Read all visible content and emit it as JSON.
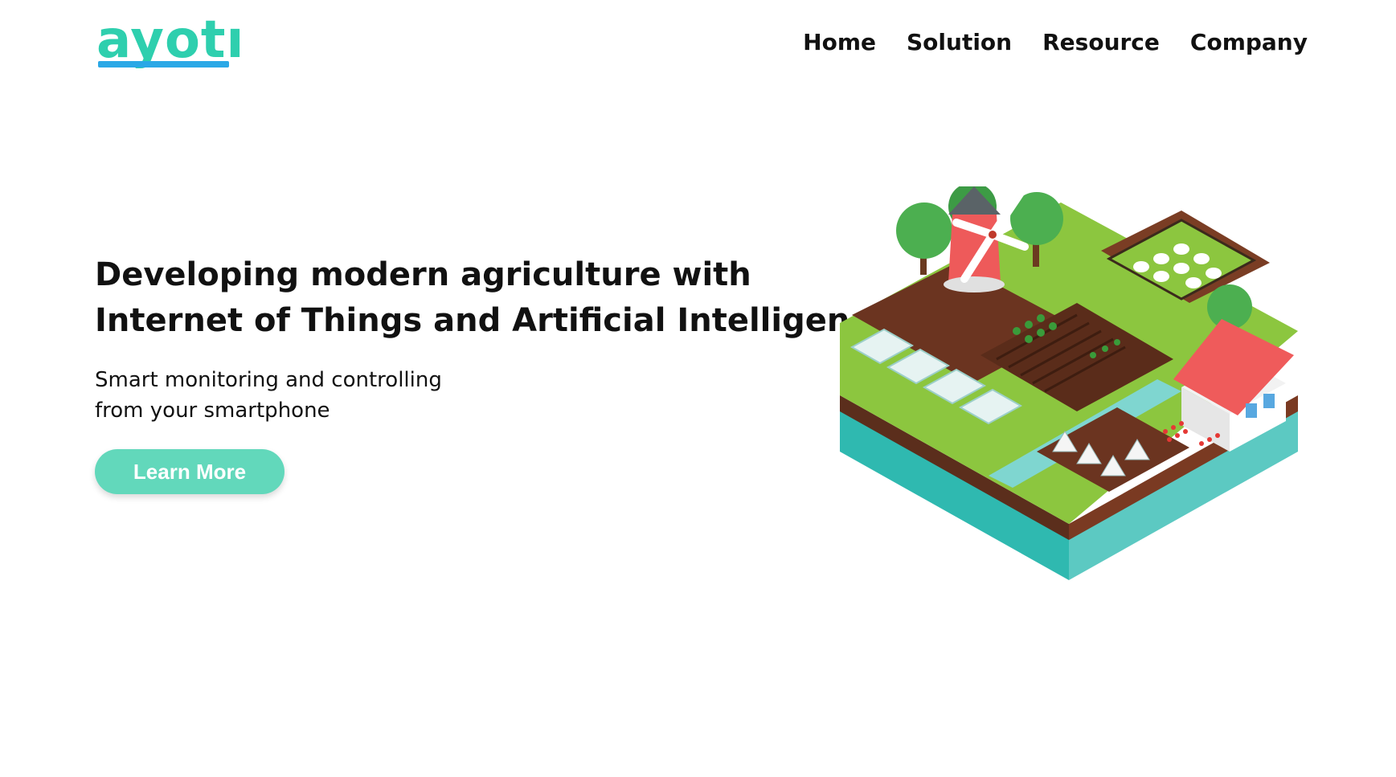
{
  "brand": {
    "logo_text": "ayotı",
    "accent": "#2ecfae",
    "underline_color": "#2aa8e6"
  },
  "nav": {
    "items": [
      "Home",
      "Solution",
      "Resource",
      "Company"
    ]
  },
  "hero": {
    "headline_lines": [
      "Developing modern agriculture with",
      "Internet of Things and Artificial Intelligence"
    ],
    "sub_lines": [
      "Smart monitoring and controlling",
      "from your smartphone"
    ],
    "cta_label": "Learn More",
    "cta_color": "#62d8bb"
  },
  "illustration": {
    "icon": "isometric-smart-farm-illustration"
  }
}
